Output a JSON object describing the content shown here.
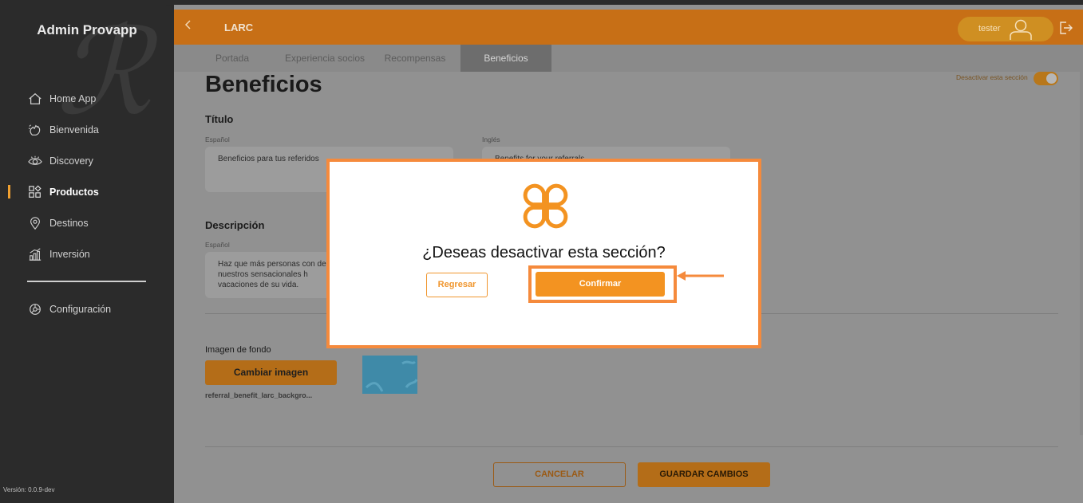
{
  "sidebar": {
    "brand": "Admin Provapp",
    "items": [
      {
        "label": "Home App",
        "icon": "home-icon"
      },
      {
        "label": "Bienvenida",
        "icon": "wave-hand-icon"
      },
      {
        "label": "Discovery",
        "icon": "eye-icon"
      },
      {
        "label": "Productos",
        "icon": "grid-icon",
        "active": true
      },
      {
        "label": "Destinos",
        "icon": "location-pin-icon"
      },
      {
        "label": "Inversión",
        "icon": "chart-icon"
      }
    ],
    "settings_label": "Configuración",
    "version": "Versión: 0.0.9-dev"
  },
  "header": {
    "back_icon": "chevron-left-icon",
    "title": "LARC",
    "user_name": "tester"
  },
  "tabs": [
    "Portada",
    "Experiencia socios",
    "Recompensas",
    "Beneficios"
  ],
  "active_tab": "Beneficios",
  "page": {
    "title": "Beneficios",
    "deactivate_label": "Desactivar esta sección",
    "titulo_section": "Título",
    "spanish_label": "Español",
    "english_label": "Inglés",
    "titulo_es": "Beneficios para tus referidos",
    "titulo_en": "Benefits for your referrals",
    "descripcion_section": "Descripción",
    "desc_es": "Haz que más personas con de nuestros sensacionales h vacaciones de su vida.",
    "image_label": "Imagen de fondo",
    "change_image": "Cambiar imagen",
    "filename": "referral_benefit_larc_backgro...",
    "cancel": "CANCELAR",
    "save": "GUARDAR CAMBIOS"
  },
  "modal": {
    "question": "¿Deseas desactivar esta sección?",
    "back_button": "Regresar",
    "confirm_button": "Confirmar"
  },
  "colors": {
    "accent": "#f39321",
    "highlight": "#f58a3c",
    "sidebar": "#2b2b2b"
  }
}
